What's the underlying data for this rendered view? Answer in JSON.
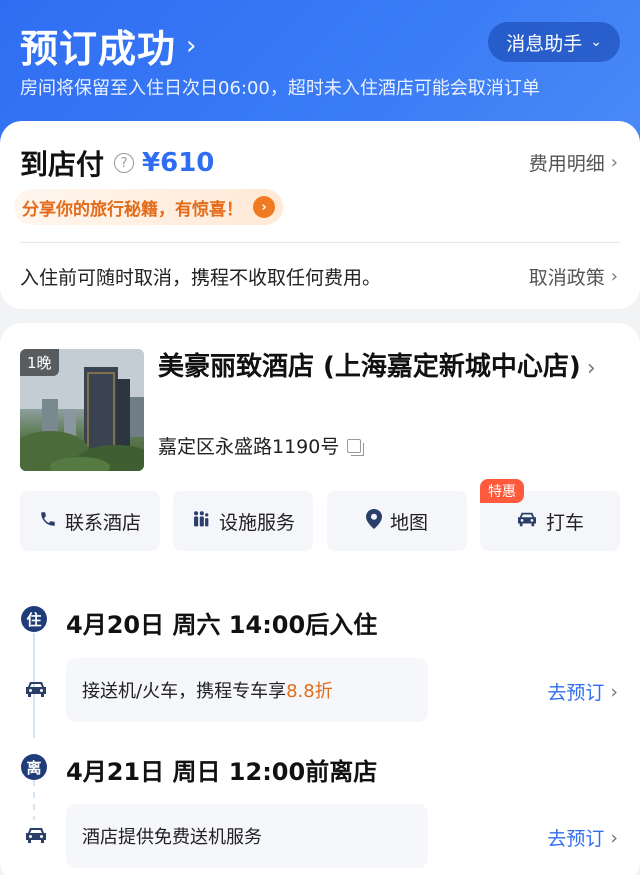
{
  "header": {
    "title": "预订成功",
    "assistant_label": "消息助手",
    "subtitle": "房间将保留至入住日次日06:00，超时未入住酒店可能会取消订单"
  },
  "payment": {
    "label": "到店付",
    "price": "¥610",
    "details_link": "费用明细",
    "share_banner": "分享你的旅行秘籍，有惊喜！",
    "cancel_text": "入住前可随时取消，携程不收取任何费用。",
    "cancel_policy_link": "取消政策"
  },
  "hotel": {
    "nights": "1晚",
    "name": "美豪丽致酒店 (上海嘉定新城中心店)",
    "address": "嘉定区永盛路1190号"
  },
  "actions": [
    {
      "label": "联系酒店",
      "icon": "phone-icon"
    },
    {
      "label": "设施服务",
      "icon": "facility-icon"
    },
    {
      "label": "地图",
      "icon": "map-pin-icon"
    },
    {
      "label": "打车",
      "icon": "car-icon",
      "badge": "特惠"
    }
  ],
  "timeline": {
    "checkin_marker": "住",
    "checkin": "4月20日  周六  14:00后入住",
    "checkin_service_text": "接送机/火车，携程专车享",
    "checkin_service_highlight": "8.8折",
    "checkin_service_link": "去预订",
    "checkout_marker": "离",
    "checkout": "4月21日  周日  12:00前离店",
    "checkout_service_text": "酒店提供免费送机服务",
    "checkout_service_link": "去预订"
  },
  "colors": {
    "brand_blue": "#2f6ef2",
    "accent_orange": "#e36b1a",
    "timeline_navy": "#1f3b79"
  }
}
